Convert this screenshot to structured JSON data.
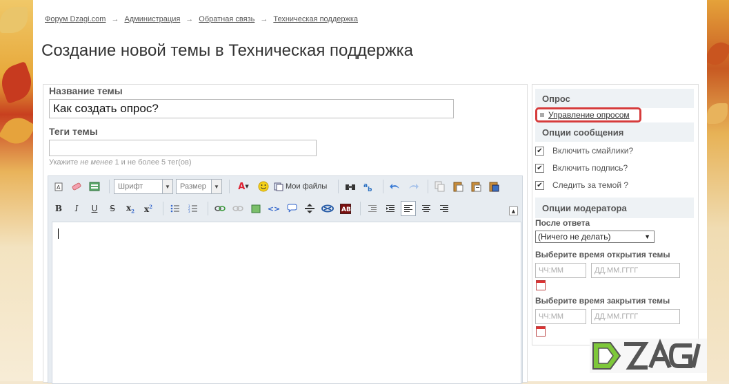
{
  "breadcrumb": [
    "Форум Dzagi.com",
    "Администрация",
    "Обратная связь",
    "Техническая поддержка"
  ],
  "page_title": "Создание новой темы в Техническая поддержка",
  "form": {
    "topic_label": "Название темы",
    "topic_value": "Как создать опрос?",
    "tags_label": "Теги темы",
    "tags_hint_before": "Укажите ",
    "tags_hint_em": "не менее",
    "tags_hint_after": " 1 и не более 5 тег(ов)"
  },
  "toolbar": {
    "font_placeholder": "Шрифт",
    "size_placeholder": "Размер",
    "my_files_label": "Мои файлы"
  },
  "sidebar": {
    "poll_heading": "Опрос",
    "poll_link": "Управление опросом",
    "message_options_heading": "Опции сообщения",
    "options": [
      "Включить смайлики?",
      "Включить подпись?",
      "Следить за темой ?"
    ],
    "moderator_heading": "Опции модератора",
    "after_reply_label": "После ответа",
    "after_reply_value": "(Ничего не делать)",
    "open_time_label": "Выберите время открытия темы",
    "close_time_label": "Выберите время закрытия темы",
    "time_placeholder": "ЧЧ:ММ",
    "date_placeholder": "ДД.ММ.ГГГГ"
  },
  "colors": {
    "highlight_border": "#d63b3b",
    "panel_header_bg": "#eef2f5",
    "logo_green": "#7ec83a"
  }
}
